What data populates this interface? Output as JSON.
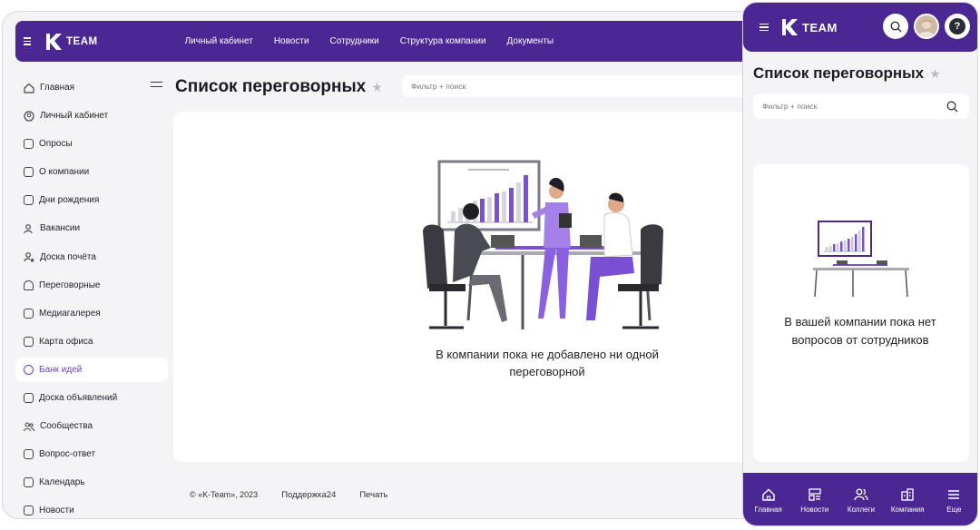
{
  "brand": {
    "name": "TEAM",
    "mark": "K"
  },
  "desktop": {
    "nav": [
      "Личный кабинет",
      "Новости",
      "Сотрудники",
      "Структура компании",
      "Документы"
    ],
    "sidebar": [
      {
        "label": "Главная",
        "icon": "home-icon"
      },
      {
        "label": "Личный кабинет",
        "icon": "user-icon"
      },
      {
        "label": "Опросы",
        "icon": "poll-icon"
      },
      {
        "label": "О компании",
        "icon": "building-icon"
      },
      {
        "label": "Дни рождения",
        "icon": "cake-icon"
      },
      {
        "label": "Вакансии",
        "icon": "vacancy-icon"
      },
      {
        "label": "Доска почёта",
        "icon": "honor-icon"
      },
      {
        "label": "Переговорные",
        "icon": "meeting-room-icon"
      },
      {
        "label": "Медиагалерея",
        "icon": "gallery-icon"
      },
      {
        "label": "Карта офиса",
        "icon": "map-icon"
      },
      {
        "label": "Банк идей",
        "icon": "lightbulb-icon",
        "active": true
      },
      {
        "label": "Доска объявлений",
        "icon": "board-icon"
      },
      {
        "label": "Сообщества",
        "icon": "community-icon"
      },
      {
        "label": "Вопрос-ответ",
        "icon": "qa-icon"
      },
      {
        "label": "Календарь",
        "icon": "calendar-icon"
      },
      {
        "label": "Новости",
        "icon": "news-icon"
      }
    ],
    "title": "Список переговорных",
    "filter_placeholder": "Фильтр + поиск",
    "empty_text": "В компании пока не добавлено ни одной переговорной",
    "footer": {
      "copyright": "© «K-Team», 2023",
      "support": "Поддержка24",
      "print": "Печать"
    }
  },
  "mobile": {
    "title": "Список переговорных",
    "filter_placeholder": "Фильтр + поиск",
    "empty_text": "В вашей компании пока нет вопросов от сотрудников",
    "help_label": "?",
    "tabs": [
      {
        "label": "Главная",
        "icon": "home-icon"
      },
      {
        "label": "Новости",
        "icon": "news-icon"
      },
      {
        "label": "Коллеги",
        "icon": "colleagues-icon"
      },
      {
        "label": "Компания",
        "icon": "company-icon"
      },
      {
        "label": "Еще",
        "icon": "menu-icon"
      }
    ]
  },
  "colors": {
    "brand": "#4a2793",
    "accent": "#6a3fc8",
    "bar": "#7b4fd4"
  }
}
